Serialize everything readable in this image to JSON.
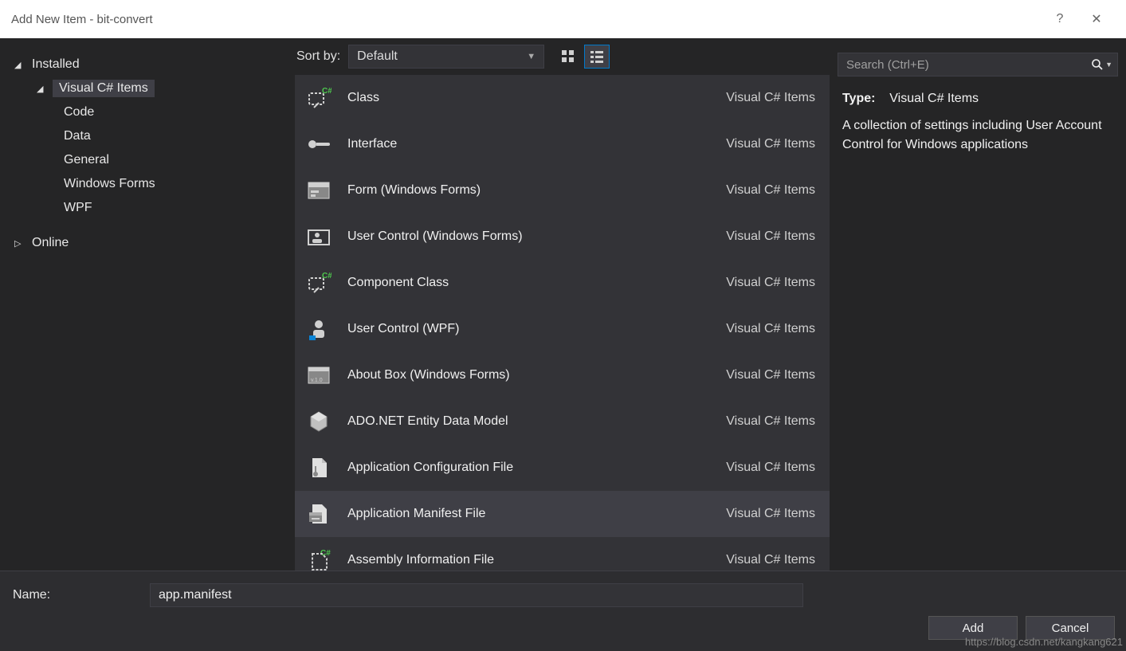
{
  "window": {
    "title": "Add New Item - bit-convert",
    "help": "?",
    "close": "✕"
  },
  "sidebar": {
    "installed": "Installed",
    "csharp": "Visual C# Items",
    "children": [
      "Code",
      "Data",
      "General",
      "Windows Forms",
      "WPF"
    ],
    "online": "Online"
  },
  "toolbar": {
    "sort_label": "Sort by:",
    "sort_value": "Default"
  },
  "search": {
    "placeholder": "Search (Ctrl+E)"
  },
  "items": [
    {
      "label": "Class",
      "category": "Visual C# Items",
      "icon": "class"
    },
    {
      "label": "Interface",
      "category": "Visual C# Items",
      "icon": "interface"
    },
    {
      "label": "Form (Windows Forms)",
      "category": "Visual C# Items",
      "icon": "form"
    },
    {
      "label": "User Control (Windows Forms)",
      "category": "Visual C# Items",
      "icon": "usercontrol"
    },
    {
      "label": "Component Class",
      "category": "Visual C# Items",
      "icon": "component"
    },
    {
      "label": "User Control (WPF)",
      "category": "Visual C# Items",
      "icon": "wpfuc"
    },
    {
      "label": "About Box (Windows Forms)",
      "category": "Visual C# Items",
      "icon": "about"
    },
    {
      "label": "ADO.NET Entity Data Model",
      "category": "Visual C# Items",
      "icon": "ado"
    },
    {
      "label": "Application Configuration File",
      "category": "Visual C# Items",
      "icon": "config"
    },
    {
      "label": "Application Manifest File",
      "category": "Visual C# Items",
      "icon": "manifest",
      "selected": true
    },
    {
      "label": "Assembly Information File",
      "category": "Visual C# Items",
      "icon": "asm"
    }
  ],
  "details": {
    "type_label": "Type:",
    "type_value": "Visual C# Items",
    "description": "A collection of settings including User Account Control for Windows applications"
  },
  "footer": {
    "name_label": "Name:",
    "name_value": "app.manifest",
    "add": "Add",
    "cancel": "Cancel"
  },
  "watermark": "https://blog.csdn.net/kangkang621"
}
